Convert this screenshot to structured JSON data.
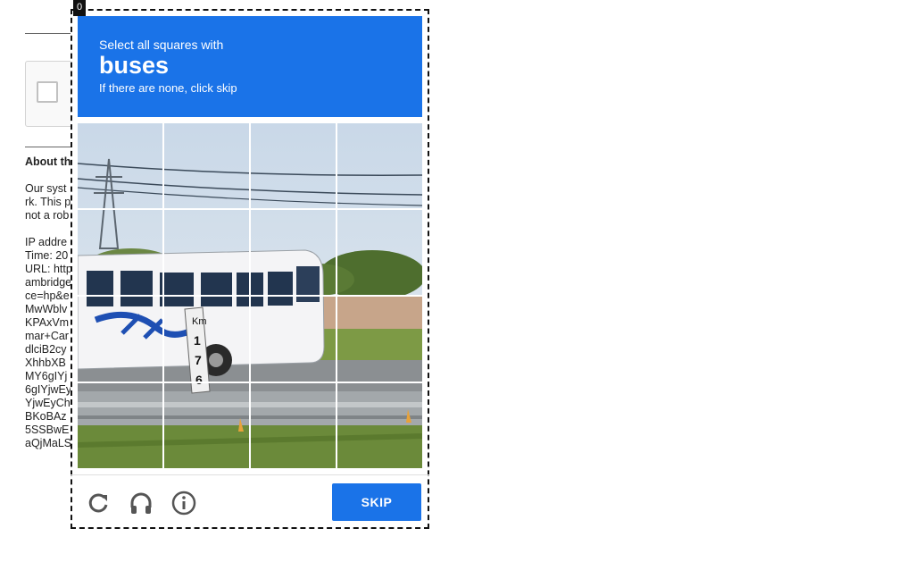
{
  "page": {
    "about_heading": "About th",
    "para_lines": [
      "Our syst",
      "rk. This p",
      "not a rob"
    ],
    "info_lines": [
      "IP addre",
      "Time: 20",
      "URL: http",
      "ambridge",
      "ce=hp&e",
      "MwWblv",
      "KPAxVm",
      "mar+Car",
      "dlciB2cy",
      "XhhbXB",
      "MY6gIYj",
      "6gIYjwEy",
      "YjwEyCh",
      "BKoBAz",
      "5SSBwE",
      "aQjMaLS"
    ]
  },
  "overlay": {
    "tag": "0"
  },
  "challenge": {
    "instruction": "Select all squares with",
    "target": "buses",
    "hint": "If there are none, click skip",
    "skip_label": "SKIP",
    "rows": 4,
    "cols": 4
  },
  "icons": {
    "reload": "reload-icon",
    "audio": "headphones-icon",
    "info": "info-icon"
  },
  "colors": {
    "accent": "#1a73e8",
    "bus_body": "#f4f4f6",
    "sky": "#d9e3ee"
  }
}
